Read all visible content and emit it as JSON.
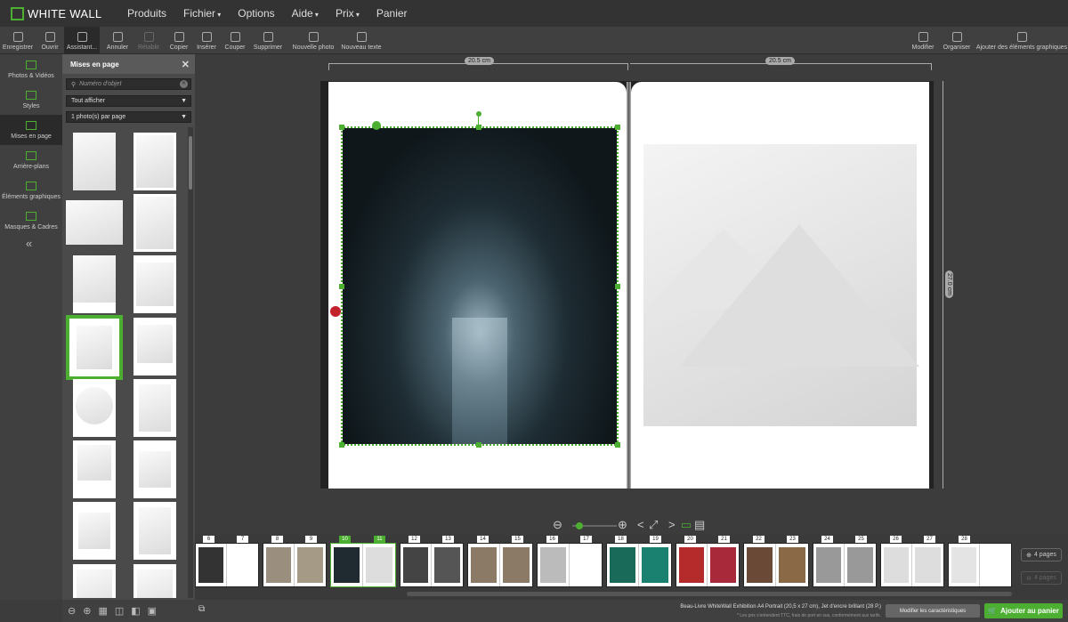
{
  "app": {
    "logo_text": "WHITE WALL",
    "menu": [
      "Produits",
      "Fichier",
      "Options",
      "Aide",
      "Prix",
      "Panier"
    ]
  },
  "toolbar": {
    "items": [
      "Enregistrer",
      "Ouvrir",
      "Assistant...",
      "Annuler",
      "Rétablir",
      "Copier",
      "Insérer",
      "Couper",
      "Supprimer",
      "Nouvelle photo",
      "Nouveau texte"
    ],
    "right": [
      "Modifier",
      "Organiser",
      "Ajouter des éléments graphiques"
    ]
  },
  "nav": {
    "items": [
      "Photos & Vidéos",
      "Styles",
      "Mises en page",
      "Arrière-plans",
      "Éléments graphiques",
      "Masques & Cadres"
    ],
    "collapse": "«"
  },
  "panel": {
    "title": "Mises en page",
    "close": "✕",
    "search_placeholder": "Numéro d'objet",
    "filter": "Tout afficher",
    "per_page": "1 photo(s) par page"
  },
  "canvas": {
    "width_left": "20.5 cm",
    "width_right": "20.5 cm",
    "height": "27.0 cm"
  },
  "zoom": {
    "minus": "⊖",
    "plus": "⊕",
    "fit": "⤢",
    "prev": "<",
    "next": ">"
  },
  "strip": {
    "pages": [
      "6",
      "7",
      "8",
      "9",
      "10",
      "11",
      "12",
      "13",
      "14",
      "15",
      "16",
      "17",
      "18",
      "19",
      "20",
      "21",
      "22",
      "23",
      "24",
      "25",
      "26",
      "27",
      "28"
    ],
    "add_pages": "4 pages",
    "remove_pages": "4 pages"
  },
  "status": {
    "product_info": "Beau-Livre WhiteWall Exhibition A4 Portrait (20,5 x 27 cm), Jet d'encre brillant (28 P.)",
    "fine_print": "* Les prix s'entendent TTC, frais de port en sus, conformément aux tarifs.",
    "modify_button": "Modifier les caractéristiques",
    "cart_button": "Ajouter au panier"
  },
  "colors": {
    "accent": "#4caf32"
  }
}
